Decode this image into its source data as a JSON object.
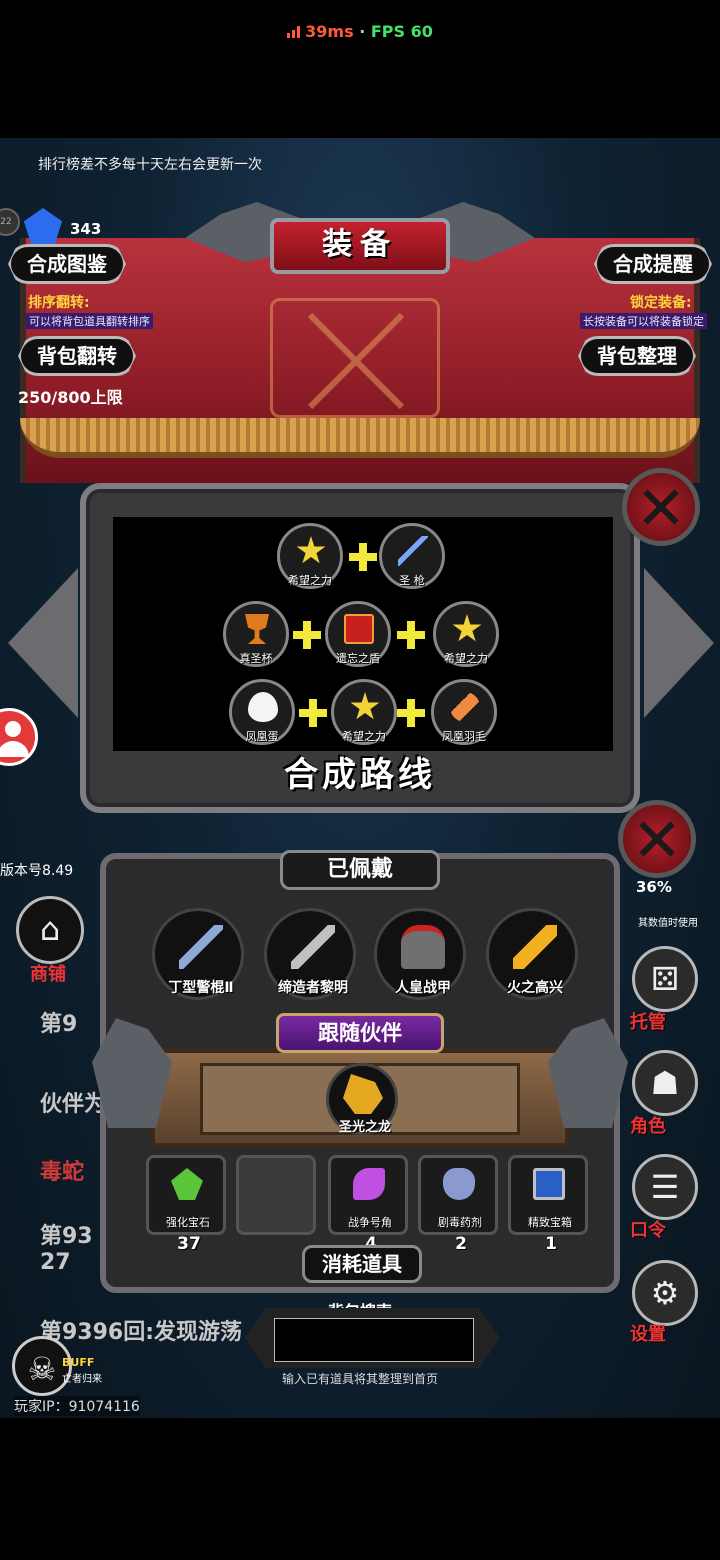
{
  "status": {
    "ping": "39ms",
    "separator": "·",
    "fps": "FPS 60"
  },
  "notice": "排行榜差不多每十天左右会更新一次",
  "resources": {
    "gems": "343"
  },
  "header": {
    "title": "装备",
    "synthesis_guide": "合成图鉴",
    "synthesis_reminder": "合成提醒",
    "sort_flip_title": "排序翻转:",
    "sort_flip_desc": "可以将背包道具翻转排序",
    "lock_equip_title": "锁定装备:",
    "lock_equip_desc": "长按装备可以将装备锁定",
    "bag_flip": "背包翻转",
    "bag_sort": "背包整理",
    "capacity": "250/800上限"
  },
  "route": {
    "title": "合成路线",
    "rows": [
      [
        {
          "name": "希望之力",
          "icon": "star-icon"
        },
        {
          "name": "圣 枪",
          "icon": "spear-icon"
        }
      ],
      [
        {
          "name": "真圣杯",
          "icon": "grail-icon"
        },
        {
          "name": "遗忘之盾",
          "icon": "shield-icon"
        },
        {
          "name": "希望之力",
          "icon": "star-icon"
        }
      ],
      [
        {
          "name": "凤凰蛋",
          "icon": "egg-icon"
        },
        {
          "name": "希望之力",
          "icon": "star-icon"
        },
        {
          "name": "凤凰羽毛",
          "icon": "feather-icon"
        }
      ]
    ]
  },
  "version": "版本号8.49",
  "equipped": {
    "title": "已佩戴",
    "items": [
      {
        "name": "丁型警棍Ⅱ",
        "icon": "trident-icon"
      },
      {
        "name": "缔造者黎明",
        "icon": "sword-icon"
      },
      {
        "name": "人皇战甲",
        "icon": "armor-icon"
      },
      {
        "name": "火之高兴",
        "icon": "fire-blade-icon"
      }
    ]
  },
  "companion": {
    "title": "跟随伙伴",
    "name": "圣光之龙",
    "icon": "dragon-icon"
  },
  "consumables": {
    "title": "消耗道具",
    "items": [
      {
        "name": "强化宝石",
        "count": "37",
        "icon": "green-gem-icon"
      },
      {
        "name": "",
        "count": "",
        "icon": ""
      },
      {
        "name": "战争号角",
        "count": "4",
        "icon": "horn-icon"
      },
      {
        "name": "剧毒药剂",
        "count": "2",
        "icon": "potion-icon"
      },
      {
        "name": "精致宝箱",
        "count": "1",
        "icon": "chest-icon"
      }
    ]
  },
  "search": {
    "label": "背包搜索",
    "value": "",
    "hint": "输入已有道具将其整理到首页"
  },
  "sidebar": {
    "shop": "商铺",
    "hosting": "托管",
    "role": "角色",
    "password": "口令",
    "settings": "设置",
    "partial_value": "36%",
    "partial_note": "其数值时使用"
  },
  "log": {
    "line1": "第9",
    "line2": "伙伴为",
    "line3": "毒蛇",
    "line4a": "第93",
    "line4b": "27",
    "line5": "第9396回:发现游荡"
  },
  "buff": {
    "label": "BUFF",
    "sub": "亡者归来"
  },
  "player_ip": "玩家IP：91074116"
}
